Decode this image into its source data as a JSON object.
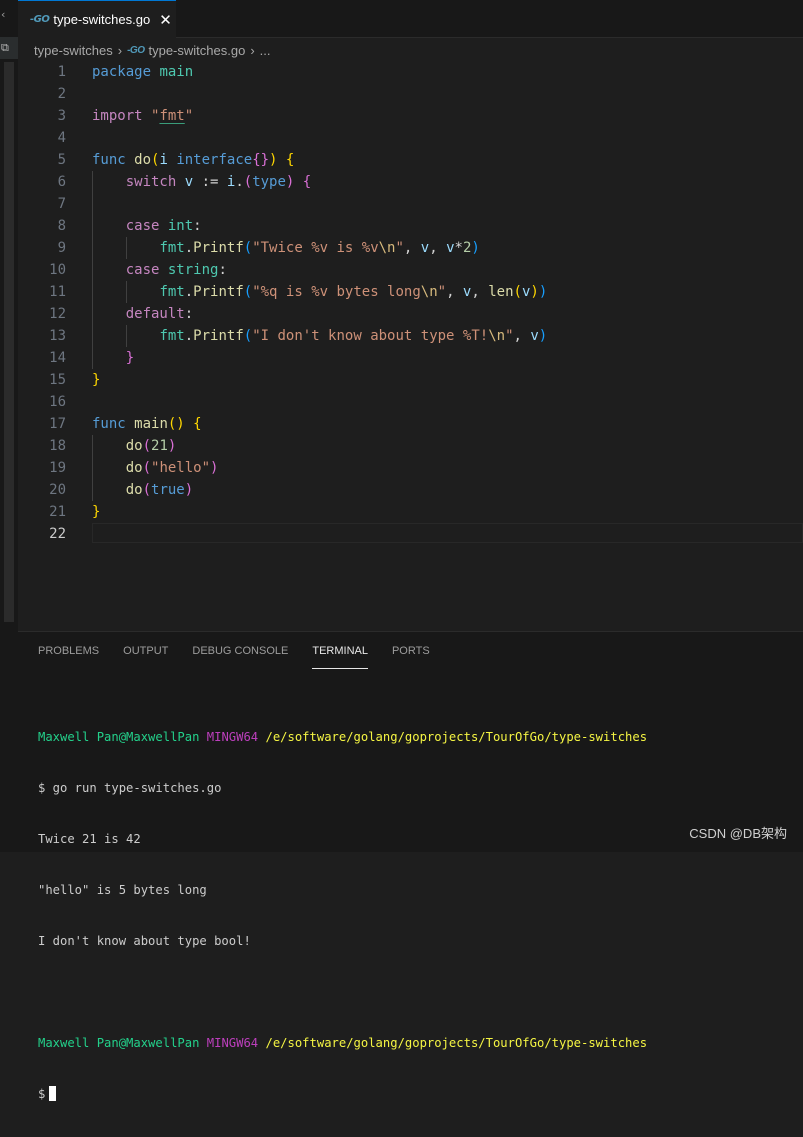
{
  "tab": {
    "icon": "go-file-icon",
    "icon_text": "-GO",
    "title": "type-switches.go",
    "close_symbol": "✕"
  },
  "breadcrumb": {
    "folder": "type-switches",
    "file": "type-switches.go",
    "ellipsis": "..."
  },
  "editor": {
    "current_line": 22,
    "lines": [
      {
        "n": "1"
      },
      {
        "n": "2"
      },
      {
        "n": "3"
      },
      {
        "n": "4"
      },
      {
        "n": "5"
      },
      {
        "n": "6"
      },
      {
        "n": "7"
      },
      {
        "n": "8"
      },
      {
        "n": "9"
      },
      {
        "n": "10"
      },
      {
        "n": "11"
      },
      {
        "n": "12"
      },
      {
        "n": "13"
      },
      {
        "n": "14"
      },
      {
        "n": "15"
      },
      {
        "n": "16"
      },
      {
        "n": "17"
      },
      {
        "n": "18"
      },
      {
        "n": "19"
      },
      {
        "n": "20"
      },
      {
        "n": "21"
      },
      {
        "n": "22"
      }
    ],
    "code": [
      [
        [
          "kw-b",
          "package"
        ],
        [
          "plain",
          " "
        ],
        [
          "typ",
          "main"
        ]
      ],
      [],
      [
        [
          "kw-p",
          "import"
        ],
        [
          "plain",
          " "
        ],
        [
          "str",
          "\""
        ],
        [
          "str ul",
          "fmt"
        ],
        [
          "str",
          "\""
        ]
      ],
      [],
      [
        [
          "kw-b",
          "func"
        ],
        [
          "plain",
          " "
        ],
        [
          "fn",
          "do"
        ],
        [
          "br1",
          "("
        ],
        [
          "var",
          "i"
        ],
        [
          "plain",
          " "
        ],
        [
          "kw-b",
          "interface"
        ],
        [
          "br2",
          "{}"
        ],
        [
          "br1",
          ")"
        ],
        [
          "plain",
          " "
        ],
        [
          "br1",
          "{"
        ]
      ],
      [
        [
          "plain",
          "    "
        ],
        [
          "kw-p",
          "switch"
        ],
        [
          "plain",
          " "
        ],
        [
          "var",
          "v"
        ],
        [
          "plain",
          " := "
        ],
        [
          "var",
          "i"
        ],
        [
          "plain",
          "."
        ],
        [
          "br2",
          "("
        ],
        [
          "kw-b",
          "type"
        ],
        [
          "br2",
          ")"
        ],
        [
          "plain",
          " "
        ],
        [
          "br2",
          "{"
        ]
      ],
      [],
      [
        [
          "plain",
          "    "
        ],
        [
          "kw-p",
          "case"
        ],
        [
          "plain",
          " "
        ],
        [
          "typ",
          "int"
        ],
        [
          "plain",
          ":"
        ]
      ],
      [
        [
          "plain",
          "        "
        ],
        [
          "typ",
          "fmt"
        ],
        [
          "plain",
          "."
        ],
        [
          "fn",
          "Printf"
        ],
        [
          "br3",
          "("
        ],
        [
          "str",
          "\"Twice %v is %v"
        ],
        [
          "esc",
          "\\n"
        ],
        [
          "str",
          "\""
        ],
        [
          "plain",
          ", "
        ],
        [
          "var",
          "v"
        ],
        [
          "plain",
          ", "
        ],
        [
          "var",
          "v"
        ],
        [
          "plain",
          "*"
        ],
        [
          "num",
          "2"
        ],
        [
          "br3",
          ")"
        ]
      ],
      [
        [
          "plain",
          "    "
        ],
        [
          "kw-p",
          "case"
        ],
        [
          "plain",
          " "
        ],
        [
          "typ",
          "string"
        ],
        [
          "plain",
          ":"
        ]
      ],
      [
        [
          "plain",
          "        "
        ],
        [
          "typ",
          "fmt"
        ],
        [
          "plain",
          "."
        ],
        [
          "fn",
          "Printf"
        ],
        [
          "br3",
          "("
        ],
        [
          "str",
          "\"%q is %v bytes long"
        ],
        [
          "esc",
          "\\n"
        ],
        [
          "str",
          "\""
        ],
        [
          "plain",
          ", "
        ],
        [
          "var",
          "v"
        ],
        [
          "plain",
          ", "
        ],
        [
          "fn",
          "len"
        ],
        [
          "br1",
          "("
        ],
        [
          "var",
          "v"
        ],
        [
          "br1",
          ")"
        ],
        [
          "br3",
          ")"
        ]
      ],
      [
        [
          "plain",
          "    "
        ],
        [
          "kw-p",
          "default"
        ],
        [
          "plain",
          ":"
        ]
      ],
      [
        [
          "plain",
          "        "
        ],
        [
          "typ",
          "fmt"
        ],
        [
          "plain",
          "."
        ],
        [
          "fn",
          "Printf"
        ],
        [
          "br3",
          "("
        ],
        [
          "str",
          "\"I don't know about type %T!"
        ],
        [
          "esc",
          "\\n"
        ],
        [
          "str",
          "\""
        ],
        [
          "plain",
          ", "
        ],
        [
          "var",
          "v"
        ],
        [
          "br3",
          ")"
        ]
      ],
      [
        [
          "plain",
          "    "
        ],
        [
          "br2",
          "}"
        ]
      ],
      [
        [
          "br1",
          "}"
        ]
      ],
      [],
      [
        [
          "kw-b",
          "func"
        ],
        [
          "plain",
          " "
        ],
        [
          "fn",
          "main"
        ],
        [
          "br1",
          "()"
        ],
        [
          "plain",
          " "
        ],
        [
          "br1",
          "{"
        ]
      ],
      [
        [
          "plain",
          "    "
        ],
        [
          "fn",
          "do"
        ],
        [
          "br2",
          "("
        ],
        [
          "num",
          "21"
        ],
        [
          "br2",
          ")"
        ]
      ],
      [
        [
          "plain",
          "    "
        ],
        [
          "fn",
          "do"
        ],
        [
          "br2",
          "("
        ],
        [
          "str",
          "\"hello\""
        ],
        [
          "br2",
          ")"
        ]
      ],
      [
        [
          "plain",
          "    "
        ],
        [
          "fn",
          "do"
        ],
        [
          "br2",
          "("
        ],
        [
          "kw-b",
          "true"
        ],
        [
          "br2",
          ")"
        ]
      ],
      [
        [
          "br1",
          "}"
        ]
      ],
      []
    ]
  },
  "panel": {
    "tabs": [
      {
        "label": "PROBLEMS",
        "active": false
      },
      {
        "label": "OUTPUT",
        "active": false
      },
      {
        "label": "DEBUG CONSOLE",
        "active": false
      },
      {
        "label": "TERMINAL",
        "active": true
      },
      {
        "label": "PORTS",
        "active": false
      }
    ],
    "terminal": {
      "user": "Maxwell Pan@MaxwellPan",
      "host": "MINGW64",
      "path": "/e/software/golang/goprojects/TourOfGo/type-switches",
      "command": "$ go run type-switches.go",
      "output": [
        "Twice 21 is 42",
        "\"hello\" is 5 bytes long",
        "I don't know about type bool!"
      ],
      "prompt": "$"
    }
  },
  "watermark": "CSDN @DB架构",
  "colors": {
    "accent": "#0078d4",
    "editor_bg": "#1e1e1e",
    "panel_bg": "#181818"
  }
}
